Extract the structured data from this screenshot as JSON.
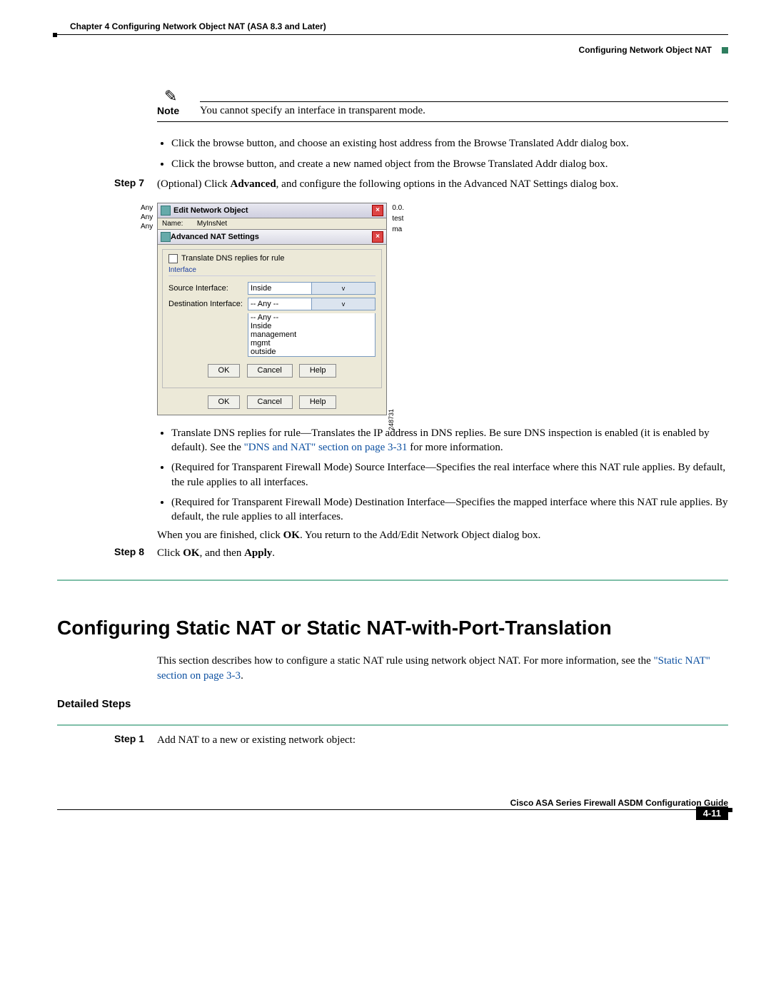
{
  "header": {
    "chapter": "Chapter 4    Configuring Network Object NAT (ASA 8.3 and Later)",
    "section": "Configuring Network Object NAT"
  },
  "note": {
    "label": "Note",
    "text": "You cannot specify an interface in transparent mode."
  },
  "bullets_top": [
    "Click the browse button, and choose an existing host address from the Browse Translated Addr dialog box.",
    "Click the browse button, and create a new named object from the Browse Translated Addr dialog box."
  ],
  "step7": {
    "label": "Step 7",
    "prefix": "(Optional) Click ",
    "bold": "Advanced",
    "suffix": ", and configure the following options in the Advanced NAT Settings dialog box."
  },
  "screenshot": {
    "left_labels": [
      "Any",
      "Any",
      "Any"
    ],
    "right_labels": [
      "0.0.",
      "test",
      "ma"
    ],
    "edit_title": "Edit Network Object",
    "name_label": "Name:",
    "name_value": "MyInsNet",
    "adv_title": "Advanced NAT Settings",
    "checkbox": "Translate DNS replies for rule",
    "fieldset": "Interface",
    "src_label": "Source Interface:",
    "src_value": "Inside",
    "dst_label": "Destination Interface:",
    "dst_value": "-- Any --",
    "options": [
      "-- Any --",
      "Inside",
      "management",
      "mgmt",
      "outside"
    ],
    "ok": "OK",
    "cancel": "Cancel",
    "help": "Help",
    "figref": "248731"
  },
  "bullets_after": {
    "b1_a": "Translate DNS replies for rule—Translates the IP address in DNS replies. Be sure DNS inspection is enabled (it is enabled by default). See the ",
    "b1_link": "\"DNS and NAT\" section on page 3-31",
    "b1_b": " for more information.",
    "b2": "(Required for Transparent Firewall Mode) Source Interface—Specifies the real interface where this NAT rule applies. By default, the rule applies to all interfaces.",
    "b3": "(Required for Transparent Firewall Mode) Destination Interface—Specifies the mapped interface where this NAT rule applies. By default, the rule applies to all interfaces."
  },
  "finish_line": {
    "a": "When you are finished, click ",
    "b": "OK",
    "c": ". You return to the Add/Edit Network Object dialog box."
  },
  "step8": {
    "label": "Step 8",
    "a": "Click ",
    "b": "OK",
    "c": ", and then ",
    "d": "Apply",
    "e": "."
  },
  "title2": "Configuring Static NAT or Static NAT-with-Port-Translation",
  "intro2": {
    "a": "This section describes how to configure a static NAT rule using network object NAT. For more information, see the ",
    "link": "\"Static NAT\" section on page 3-3",
    "b": "."
  },
  "detailed": "Detailed Steps",
  "step1": {
    "label": "Step 1",
    "text": "Add NAT to a new or existing network object:"
  },
  "footer": {
    "guide": "Cisco ASA Series Firewall ASDM Configuration Guide",
    "page": "4-11"
  }
}
